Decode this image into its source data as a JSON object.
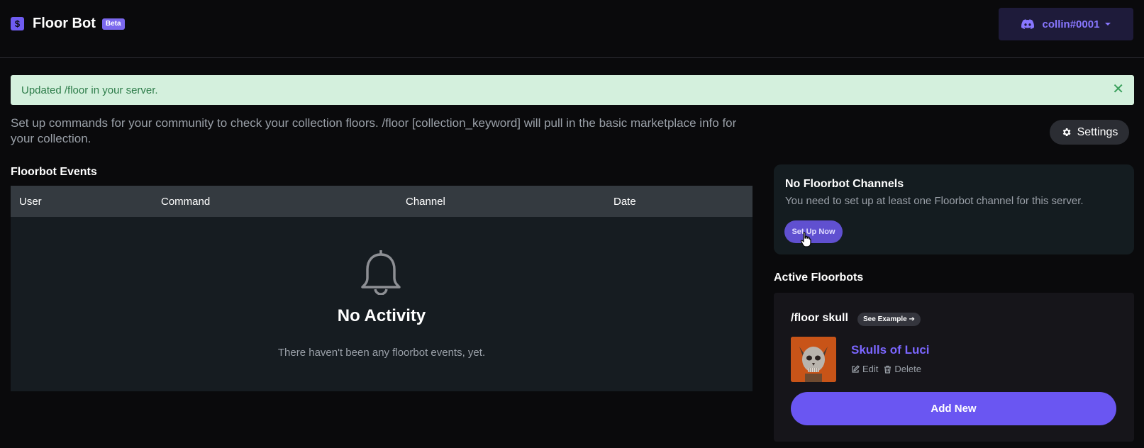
{
  "brand": {
    "logo_glyph": "$",
    "title": "Floor Bot",
    "badge": "Beta"
  },
  "user": {
    "name": "collin#0001",
    "icon": "discord-icon"
  },
  "alert": {
    "message": "Updated /floor in your server.",
    "close_glyph": "✕"
  },
  "description": "Set up commands for your community to check your collection floors. /floor [collection_keyword] will pull in the basic marketplace info for your collection.",
  "settings": {
    "label": "Settings",
    "icon": "gear-icon"
  },
  "events": {
    "title": "Floorbot Events",
    "columns": [
      "User",
      "Command",
      "Channel",
      "Date"
    ],
    "empty_title": "No Activity",
    "empty_text": "There haven't been any floorbot events, yet."
  },
  "channels": {
    "title": "No Floorbot Channels",
    "text": "You need to set up at least one Floorbot channel for this server.",
    "button": "Set Up Now"
  },
  "active": {
    "title": "Active Floorbots",
    "command": "/floor skull",
    "see_example": "See Example ➔",
    "collection": "Skulls of Luci",
    "edit": "Edit",
    "delete": "Delete",
    "add_new": "Add New"
  },
  "colors": {
    "accent": "#6a56f2",
    "background": "#0a0a0c",
    "alert_bg": "#d4f0dd",
    "alert_text": "#2e7d4a"
  }
}
